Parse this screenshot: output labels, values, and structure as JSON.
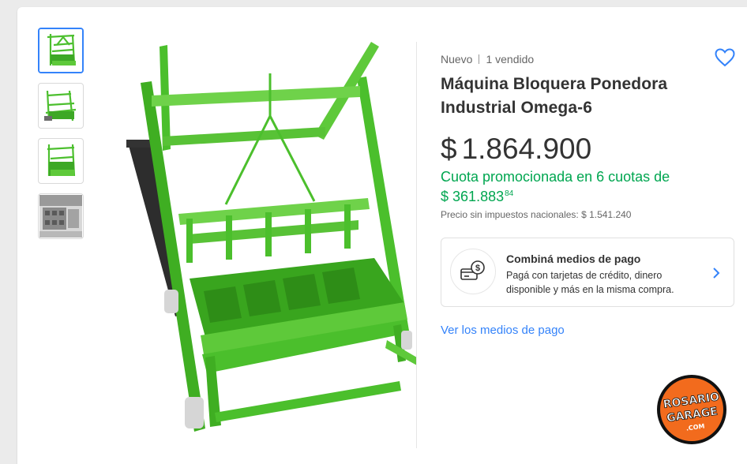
{
  "product": {
    "condition": "Nuevo",
    "sold": "1 vendido",
    "title": "Máquina Bloquera Ponedora Industrial Omega-6",
    "price_currency": "$",
    "price_amount": "1.864.900",
    "installment_text": "Cuota promocionada en 6 cuotas de",
    "installment_currency": "$",
    "installment_amount": "361.883",
    "installment_cents": "84",
    "tax_text": "Precio sin impuestos nacionales: $ 1.541.240"
  },
  "payment": {
    "title": "Combiná medios de pago",
    "description": "Pagá con tarjetas de crédito, dinero disponible y más en la misma compra.",
    "link": "Ver los medios de pago"
  },
  "logo": {
    "line1": "ROSARIO",
    "line2": "GARAGE",
    "line3": ".COM"
  },
  "colors": {
    "accent": "#3483fa",
    "green": "#00a650",
    "machine_green": "#5ec93a",
    "logo_orange": "#f26b1d"
  },
  "icons": {
    "favorite": "heart-outline-icon",
    "payment": "card-money-icon",
    "chevron": "chevron-right-icon"
  }
}
